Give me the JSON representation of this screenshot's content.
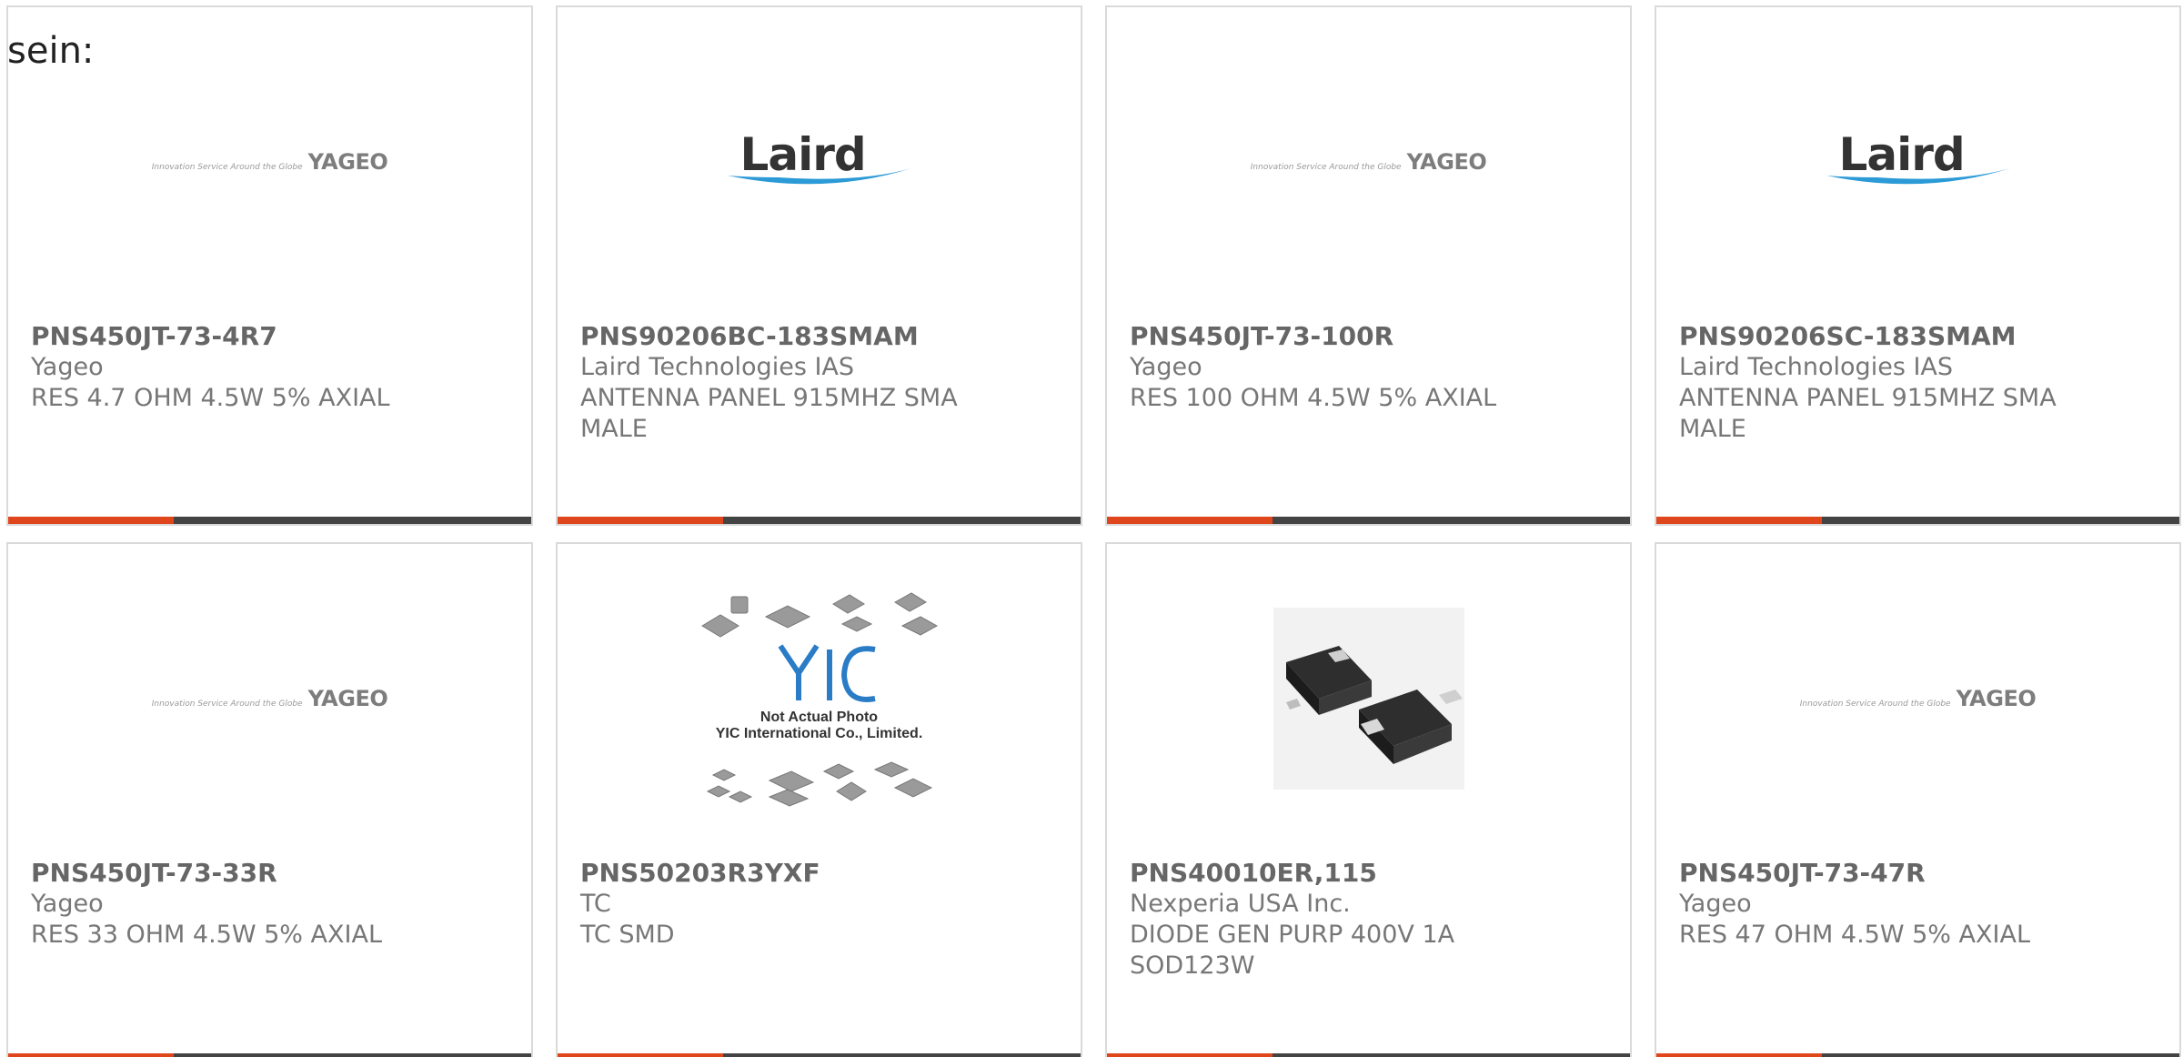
{
  "intro_text": "sein:",
  "colors": {
    "accent": "#e0461c",
    "bar_dark": "#444444",
    "border": "#dadada",
    "text": "#666666"
  },
  "cards": [
    {
      "part_number": "PNS450JT-73-4R7",
      "manufacturer": "Yageo",
      "description": "RES 4.7 OHM 4.5W 5% AXIAL",
      "logo": "yageo-logo",
      "logo_text": "YAGEO",
      "logo_tagline": "Innovation Service Around the Globe"
    },
    {
      "part_number": "PNS90206BC-183SMAM",
      "manufacturer": "Laird Technologies IAS",
      "description": "ANTENNA PANEL 915MHZ SMA MALE",
      "logo": "laird-logo",
      "logo_text": "Laird"
    },
    {
      "part_number": "PNS450JT-73-100R",
      "manufacturer": "Yageo",
      "description": "RES 100 OHM 4.5W 5% AXIAL",
      "logo": "yageo-logo",
      "logo_text": "YAGEO",
      "logo_tagline": "Innovation Service Around the Globe"
    },
    {
      "part_number": "PNS90206SC-183SMAM",
      "manufacturer": "Laird Technologies IAS",
      "description": "ANTENNA PANEL 915MHZ SMA MALE",
      "logo": "laird-logo",
      "logo_text": "Laird"
    },
    {
      "part_number": "PNS450JT-73-33R",
      "manufacturer": "Yageo",
      "description": "RES 33 OHM 4.5W 5% AXIAL",
      "logo": "yageo-logo",
      "logo_text": "YAGEO",
      "logo_tagline": "Innovation Service Around the Globe"
    },
    {
      "part_number": "PNS50203R3YXF",
      "manufacturer": "TC",
      "description": "TC SMD",
      "logo": "yic-placeholder-image",
      "logo_text": "YIC",
      "note_line1": "Not Actual Photo",
      "note_line2": "YIC International Co., Limited."
    },
    {
      "part_number": "PNS40010ER,115",
      "manufacturer": "Nexperia USA Inc.",
      "description": "DIODE GEN PURP 400V 1A SOD123W",
      "logo": "diode-photo"
    },
    {
      "part_number": "PNS450JT-73-47R",
      "manufacturer": "Yageo",
      "description": "RES 47 OHM 4.5W 5% AXIAL",
      "logo": "yageo-logo",
      "logo_text": "YAGEO",
      "logo_tagline": "Innovation Service Around the Globe"
    }
  ]
}
